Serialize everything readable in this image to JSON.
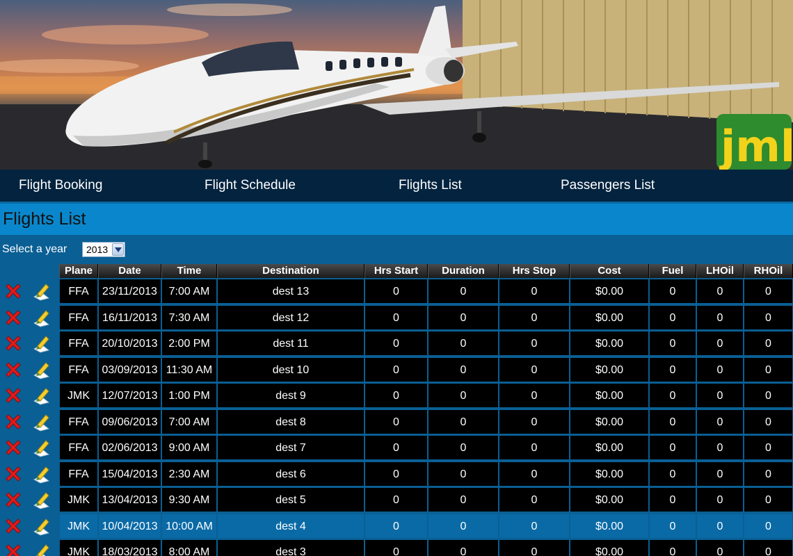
{
  "nav": {
    "items": [
      "Flight Booking",
      "Flight Schedule",
      "Flights List",
      "Passengers List"
    ]
  },
  "logo": {
    "text": "JMK"
  },
  "page": {
    "title": "Flights List"
  },
  "year_filter": {
    "label": "Select a year",
    "selected": "2013"
  },
  "table": {
    "columns": [
      "Plane",
      "Date",
      "Time",
      "Destination",
      "Hrs Start",
      "Duration",
      "Hrs Stop",
      "Cost",
      "Fuel",
      "LHOil",
      "RHOil"
    ],
    "rows": [
      [
        "FFA",
        "23/11/2013",
        "7:00 AM",
        "dest 13",
        "0",
        "0",
        "0",
        "$0.00",
        "0",
        "0",
        "0"
      ],
      [
        "FFA",
        "16/11/2013",
        "7:30 AM",
        "dest 12",
        "0",
        "0",
        "0",
        "$0.00",
        "0",
        "0",
        "0"
      ],
      [
        "FFA",
        "20/10/2013",
        "2:00 PM",
        "dest 11",
        "0",
        "0",
        "0",
        "$0.00",
        "0",
        "0",
        "0"
      ],
      [
        "FFA",
        "03/09/2013",
        "11:30 AM",
        "dest 10",
        "0",
        "0",
        "0",
        "$0.00",
        "0",
        "0",
        "0"
      ],
      [
        "JMK",
        "12/07/2013",
        "1:00 PM",
        "dest 9",
        "0",
        "0",
        "0",
        "$0.00",
        "0",
        "0",
        "0"
      ],
      [
        "FFA",
        "09/06/2013",
        "7:00 AM",
        "dest 8",
        "0",
        "0",
        "0",
        "$0.00",
        "0",
        "0",
        "0"
      ],
      [
        "FFA",
        "02/06/2013",
        "9:00 AM",
        "dest 7",
        "0",
        "0",
        "0",
        "$0.00",
        "0",
        "0",
        "0"
      ],
      [
        "FFA",
        "15/04/2013",
        "2:30 AM",
        "dest 6",
        "0",
        "0",
        "0",
        "$0.00",
        "0",
        "0",
        "0"
      ],
      [
        "JMK",
        "13/04/2013",
        "9:30 AM",
        "dest 5",
        "0",
        "0",
        "0",
        "$0.00",
        "0",
        "0",
        "0"
      ],
      [
        "JMK",
        "10/04/2013",
        "10:00 AM",
        "dest 4",
        "0",
        "0",
        "0",
        "$0.00",
        "0",
        "0",
        "0"
      ],
      [
        "JMK",
        "18/03/2013",
        "8:00 AM",
        "dest 3",
        "0",
        "0",
        "0",
        "$0.00",
        "0",
        "0",
        "0"
      ]
    ],
    "selected_row": 9
  },
  "icons": {
    "delete": "delete-x-icon",
    "edit": "edit-pencil-icon"
  },
  "colors": {
    "nav_bg": "#03233e",
    "title_band": "#0a87cc",
    "page_bg": "#0a5f94",
    "selected_row": "#0a6aa6",
    "logo_yellow": "#f2d21b",
    "logo_green": "#2e8b2e"
  }
}
